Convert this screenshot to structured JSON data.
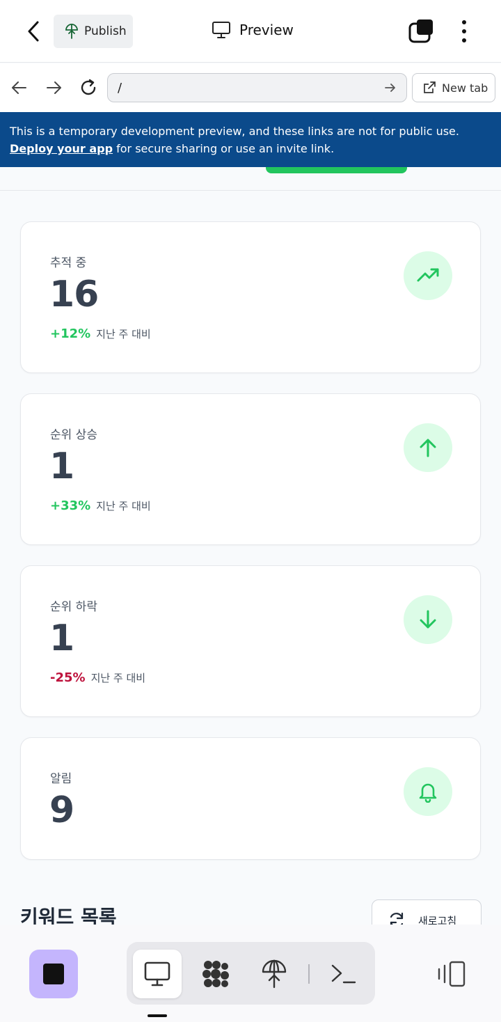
{
  "appbar": {
    "publish_label": "Publish",
    "title": "Preview"
  },
  "browser": {
    "url": "/",
    "new_tab_label": "New tab"
  },
  "banner": {
    "text": "This is a temporary development preview, and these links are not for public use.",
    "link_text": "Deploy your app",
    "suffix_text": " for secure sharing or use an invite link."
  },
  "stats": [
    {
      "label": "추적 중",
      "value": "16",
      "change": "+12%",
      "note": "지난 주 대비",
      "change_color": "#22c55e",
      "icon": "trending-up-icon"
    },
    {
      "label": "순위 상승",
      "value": "1",
      "change": "+33%",
      "note": "지난 주 대비",
      "change_color": "#22c55e",
      "icon": "arrow-up-icon"
    },
    {
      "label": "순위 하락",
      "value": "1",
      "change": "-25%",
      "note": "지난 주 대비",
      "change_color": "#be123c",
      "icon": "arrow-down-icon"
    },
    {
      "label": "알림",
      "value": "9",
      "icon": "bell-icon"
    }
  ],
  "keywords": {
    "title": "키워드 목록",
    "refresh_label": "새로고침"
  },
  "colors": {
    "accent_green": "#22c55e",
    "icon_bg": "#dcfce7",
    "banner_bg": "#0b4a8b",
    "stop_bg": "#c4b5fd"
  }
}
